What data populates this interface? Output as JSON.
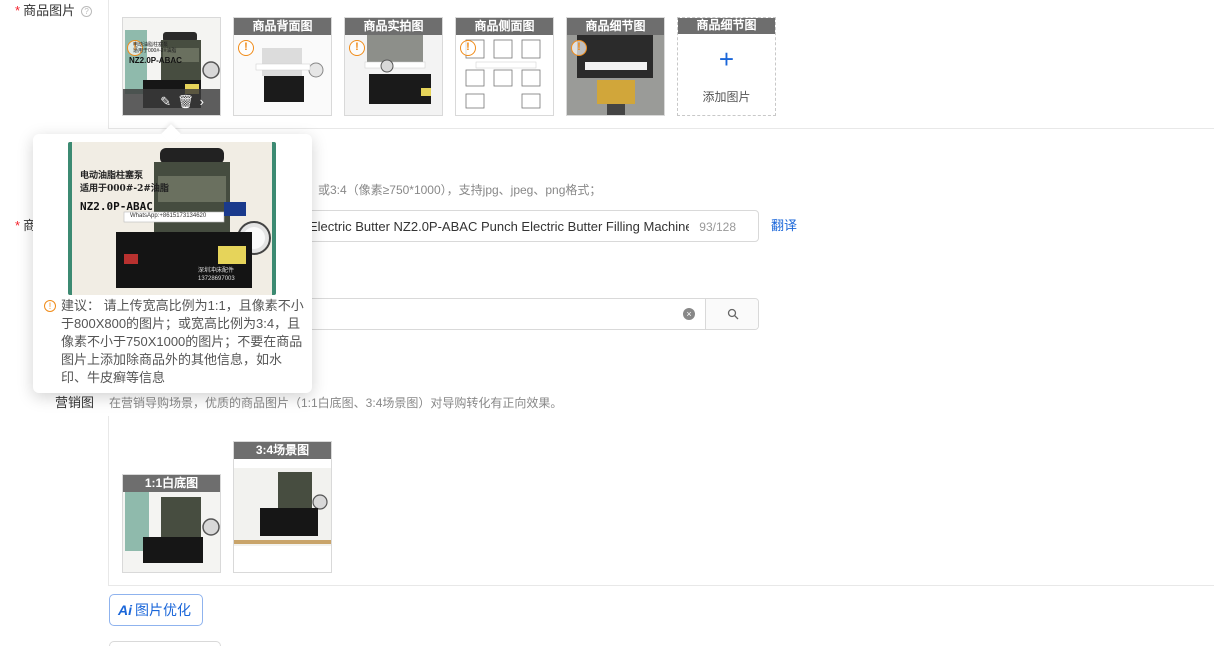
{
  "product_images": {
    "label": "商品图片",
    "required_mark": "*",
    "help_icon": "?",
    "slots": [
      {
        "tag": ""
      },
      {
        "tag": "商品背面图"
      },
      {
        "tag": "商品实拍图"
      },
      {
        "tag": "商品侧面图"
      },
      {
        "tag": "商品细节图"
      }
    ],
    "add_slot": {
      "tag": "商品细节图",
      "plus": "+",
      "label": "添加图片"
    },
    "toolbar_icons": [
      "edit-icon",
      "delete-icon",
      "chevron-right-icon"
    ]
  },
  "photo_watermark": {
    "line1": "电动油脂柱塞泵",
    "line2": "适用于000#-2#油脂",
    "model": "NZ2.0P-ABAC",
    "whatsapp": "WhatsApp:+8615173134620",
    "store": "深圳冲床配件",
    "phone": "13728697003"
  },
  "popover": {
    "prefix": "建议：",
    "text": "请上传宽高比例为1:1，且像素不小于800X800的图片；或宽高比例为3:4，且像素不小于750X1000的图片；不要在商品图片上添加除商品外的其他信息，如水印、牛皮癣等信息"
  },
  "image_hint": "或3:4（像素≥750*1000），支持jpg、jpeg、png格式；",
  "title_field": {
    "label_fragment": "商",
    "required_mark": "*",
    "value": "Electric Butter NZ2.0P-ABAC Punch Electric Butter Filling Machine",
    "count": "93/128",
    "translate": "翻译"
  },
  "search_field": {
    "value": "",
    "clear_icon": "×"
  },
  "marketing": {
    "label": "营销图",
    "hint": "在营销导购场景，优质的商品图片（1:1白底图、3:4场景图）对导购转化有正向效果。",
    "slots": [
      {
        "tag": "1:1白底图"
      },
      {
        "tag": "3:4场景图"
      }
    ]
  },
  "ai_button": {
    "badge": "Ai",
    "label": "图片优化"
  },
  "colors": {
    "accent": "#1a66d9",
    "required": "#f5222d",
    "warn": "#f08c1a",
    "tag_bg": "#6e6e6e"
  }
}
